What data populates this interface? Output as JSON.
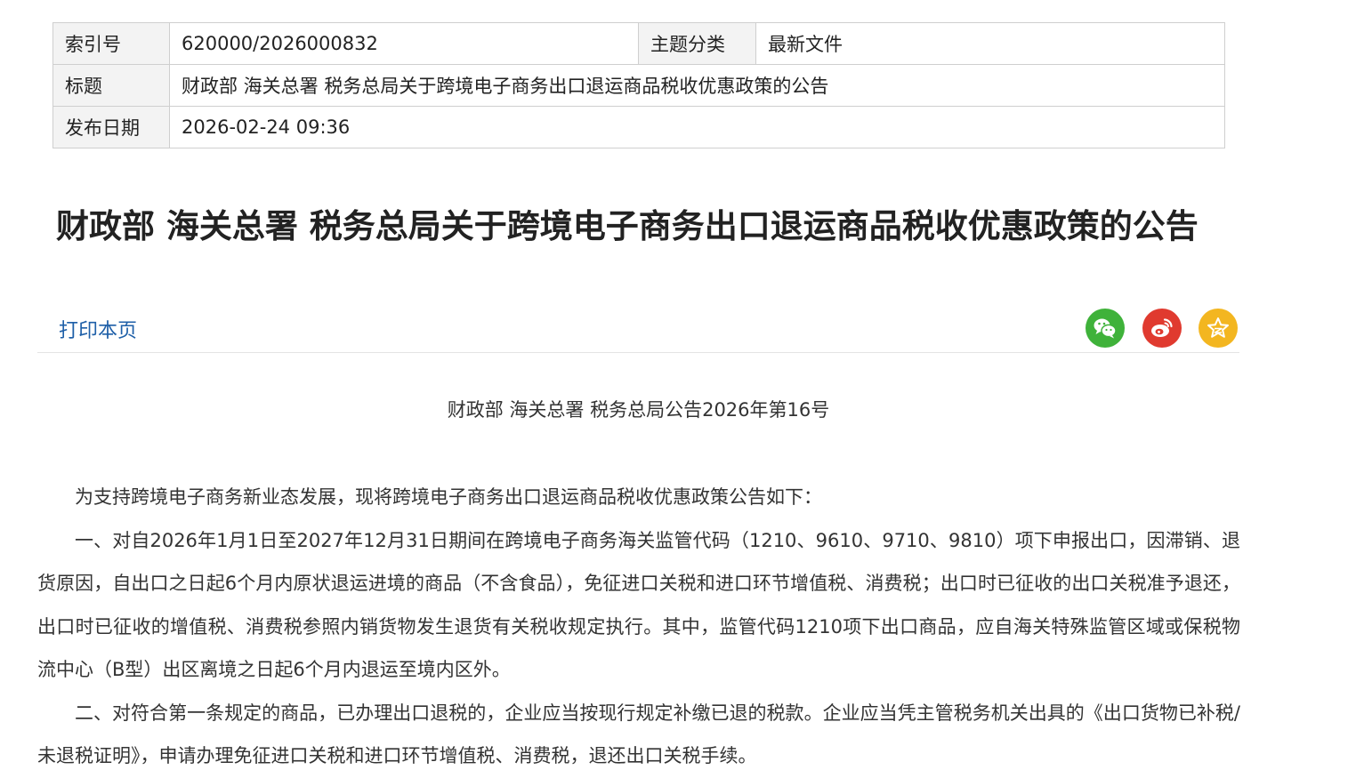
{
  "meta": {
    "index_label": "索引号",
    "index_value": "620000/2026000832",
    "category_label": "主题分类",
    "category_value": "最新文件",
    "title_label": "标题",
    "title_value": "财政部 海关总署 税务总局关于跨境电子商务出口退运商品税收优惠政策的公告",
    "date_label": "发布日期",
    "date_value": "2026-02-24 09:36"
  },
  "article": {
    "title": "财政部 海关总署 税务总局关于跨境电子商务出口退运商品税收优惠政策的公告",
    "doc_number": "财政部 海关总署 税务总局公告2026年第16号",
    "paragraphs": [
      "为支持跨境电子商务新业态发展，现将跨境电子商务出口退运商品税收优惠政策公告如下：",
      "一、对自2026年1月1日至2027年12月31日期间在跨境电子商务海关监管代码（1210、9610、9710、9810）项下申报出口，因滞销、退货原因，自出口之日起6个月内原状退运进境的商品（不含食品），免征进口关税和进口环节增值税、消费税；出口时已征收的出口关税准予退还，出口时已征收的增值税、消费税参照内销货物发生退货有关税收规定执行。其中，监管代码1210项下出口商品，应自海关特殊监管区域或保税物流中心（B型）出区离境之日起6个月内退运至境内区外。",
      "二、对符合第一条规定的商品，已办理出口退税的，企业应当按现行规定补缴已退的税款。企业应当凭主管税务机关出具的《出口货物已补税/未退税证明》，申请办理免征进口关税和进口环节增值税、消费税，退还出口关税手续。"
    ]
  },
  "toolbar": {
    "print_label": "打印本页",
    "share_wechat_icon": "wechat-icon",
    "share_weibo_icon": "weibo-icon",
    "favorite_icon": "star-icon",
    "colors": {
      "wechat": "#3fb23a",
      "weibo": "#e03a2f",
      "favorite": "#f3b620",
      "link": "#1e5fa8"
    }
  }
}
